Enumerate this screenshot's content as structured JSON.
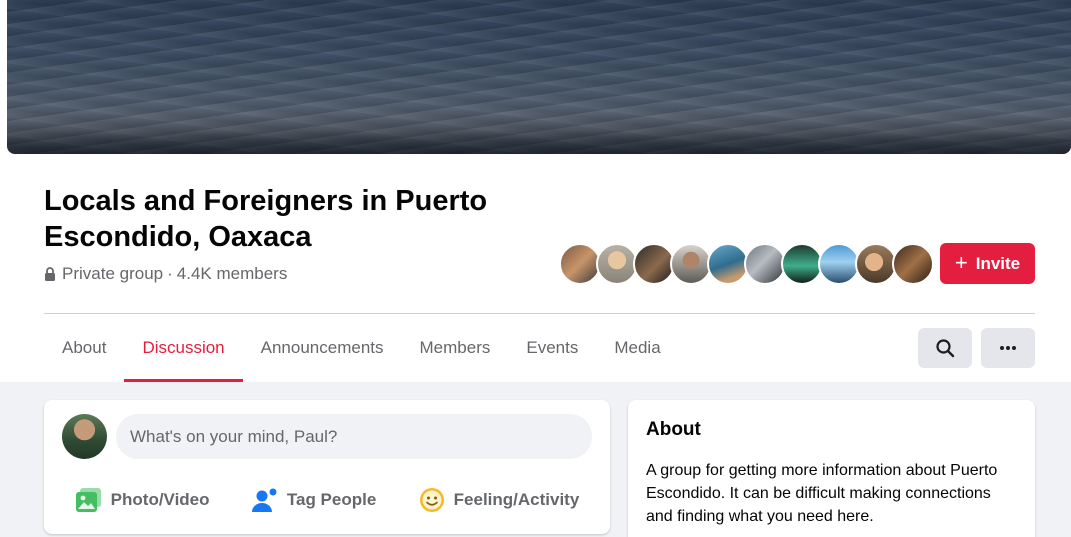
{
  "group": {
    "name": "Locals and Foreigners in Puerto Escondido, Oaxaca",
    "privacy": "Private group",
    "separator": "·",
    "members": "4.4K members"
  },
  "invite_button": {
    "label": "Invite"
  },
  "member_avatars": [
    "member-1",
    "member-2",
    "member-3",
    "member-4",
    "member-5",
    "member-6",
    "member-7",
    "member-8",
    "member-9",
    "member-10"
  ],
  "tabs": [
    {
      "label": "About",
      "active": false
    },
    {
      "label": "Discussion",
      "active": true
    },
    {
      "label": "Announcements",
      "active": false
    },
    {
      "label": "Members",
      "active": false
    },
    {
      "label": "Events",
      "active": false
    },
    {
      "label": "Media",
      "active": false
    }
  ],
  "composer": {
    "placeholder": "What's on your mind, Paul?",
    "actions": [
      {
        "label": "Photo/Video",
        "icon": "photo-video-icon"
      },
      {
        "label": "Tag People",
        "icon": "tag-people-icon"
      },
      {
        "label": "Feeling/Activity",
        "icon": "feeling-activity-icon"
      }
    ]
  },
  "about": {
    "heading": "About",
    "description": "A group for getting more information about Puerto Escondido. It can be difficult making connections and finding what you need here."
  },
  "colors": {
    "accent": "#e41e3f",
    "secondary_text": "#65676b",
    "page_bg": "#f0f2f5",
    "button_bg": "#e4e6eb"
  }
}
